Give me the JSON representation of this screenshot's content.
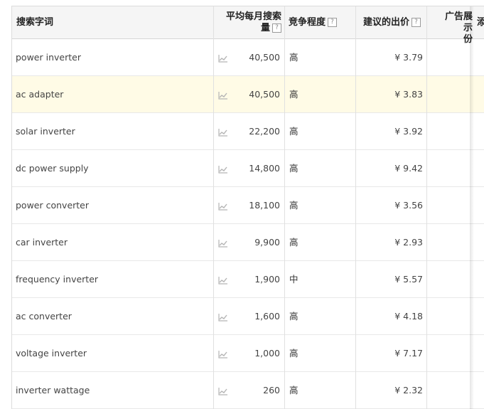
{
  "header": {
    "keyword": "搜索字词",
    "volume_line1": "平均每月搜索",
    "volume_line2": "量",
    "competition": "竞争程度",
    "bid": "建议的出价",
    "impression_line1": "广告展示",
    "impression_line2": "份",
    "add": "添",
    "help_glyph": "?"
  },
  "trend_icon": "line-chart-icon",
  "currency_symbol": "¥",
  "rows": [
    {
      "keyword": "power inverter",
      "volume": "40,500",
      "competition": "高",
      "bid": "¥ 3.79"
    },
    {
      "keyword": "ac adapter",
      "volume": "40,500",
      "competition": "高",
      "bid": "¥ 3.83"
    },
    {
      "keyword": "solar inverter",
      "volume": "22,200",
      "competition": "高",
      "bid": "¥ 3.92"
    },
    {
      "keyword": "dc power supply",
      "volume": "14,800",
      "competition": "高",
      "bid": "¥ 9.42"
    },
    {
      "keyword": "power converter",
      "volume": "18,100",
      "competition": "高",
      "bid": "¥ 3.56"
    },
    {
      "keyword": "car inverter",
      "volume": "9,900",
      "competition": "高",
      "bid": "¥ 2.93"
    },
    {
      "keyword": "frequency inverter",
      "volume": "1,900",
      "competition": "中",
      "bid": "¥ 5.57"
    },
    {
      "keyword": "ac converter",
      "volume": "1,600",
      "competition": "高",
      "bid": "¥ 4.18"
    },
    {
      "keyword": "voltage inverter",
      "volume": "1,000",
      "competition": "高",
      "bid": "¥ 7.17"
    },
    {
      "keyword": "inverter wattage",
      "volume": "260",
      "competition": "高",
      "bid": "¥ 2.32"
    }
  ],
  "colors": {
    "highlight_row": "#fffbe6",
    "header_bg": "#f5f5f5"
  }
}
